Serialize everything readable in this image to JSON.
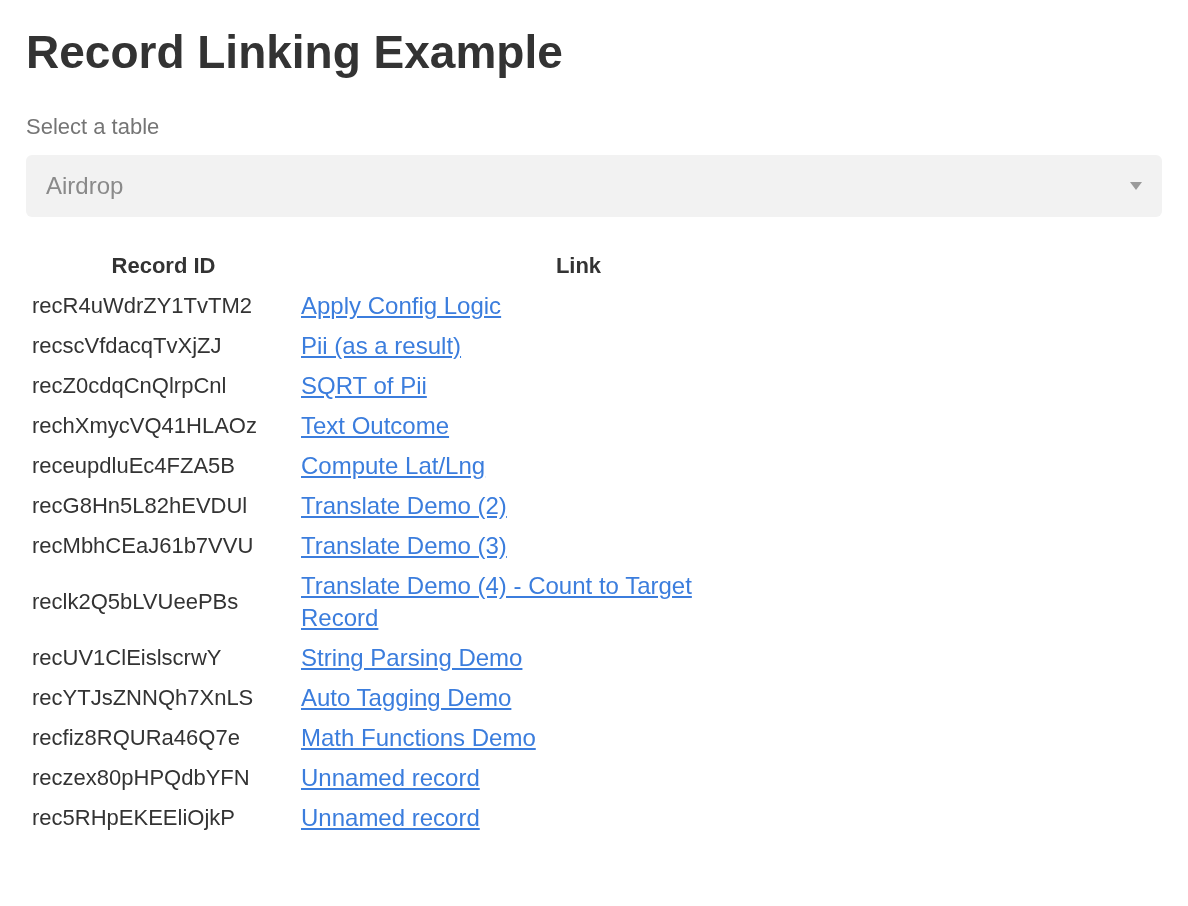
{
  "title": "Record Linking Example",
  "table_select": {
    "label": "Select a table",
    "value": "Airdrop"
  },
  "table": {
    "columns": [
      "Record ID",
      "Link"
    ],
    "rows": [
      {
        "record_id": "recR4uWdrZY1TvTM2",
        "link": "Apply Config Logic"
      },
      {
        "record_id": "recscVfdacqTvXjZJ",
        "link": "Pii (as a result)"
      },
      {
        "record_id": "recZ0cdqCnQlrpCnl",
        "link": "SQRT of Pii"
      },
      {
        "record_id": "rechXmycVQ41HLAOz",
        "link": "Text Outcome"
      },
      {
        "record_id": "receupdluEc4FZA5B",
        "link": "Compute Lat/Lng"
      },
      {
        "record_id": "recG8Hn5L82hEVDUl",
        "link": "Translate Demo (2)"
      },
      {
        "record_id": "recMbhCEaJ61b7VVU",
        "link": "Translate Demo (3)"
      },
      {
        "record_id": "reclk2Q5bLVUeePBs",
        "link": "Translate Demo (4) - Count to Target Record"
      },
      {
        "record_id": "recUV1ClEislscrwY",
        "link": "String Parsing Demo"
      },
      {
        "record_id": "recYTJsZNNQh7XnLS",
        "link": "Auto Tagging Demo"
      },
      {
        "record_id": "recfiz8RQURa46Q7e",
        "link": "Math Functions Demo"
      },
      {
        "record_id": "reczex80pHPQdbYFN",
        "link": "Unnamed record"
      },
      {
        "record_id": "rec5RHpEKEEliOjkP",
        "link": "Unnamed record"
      }
    ]
  }
}
